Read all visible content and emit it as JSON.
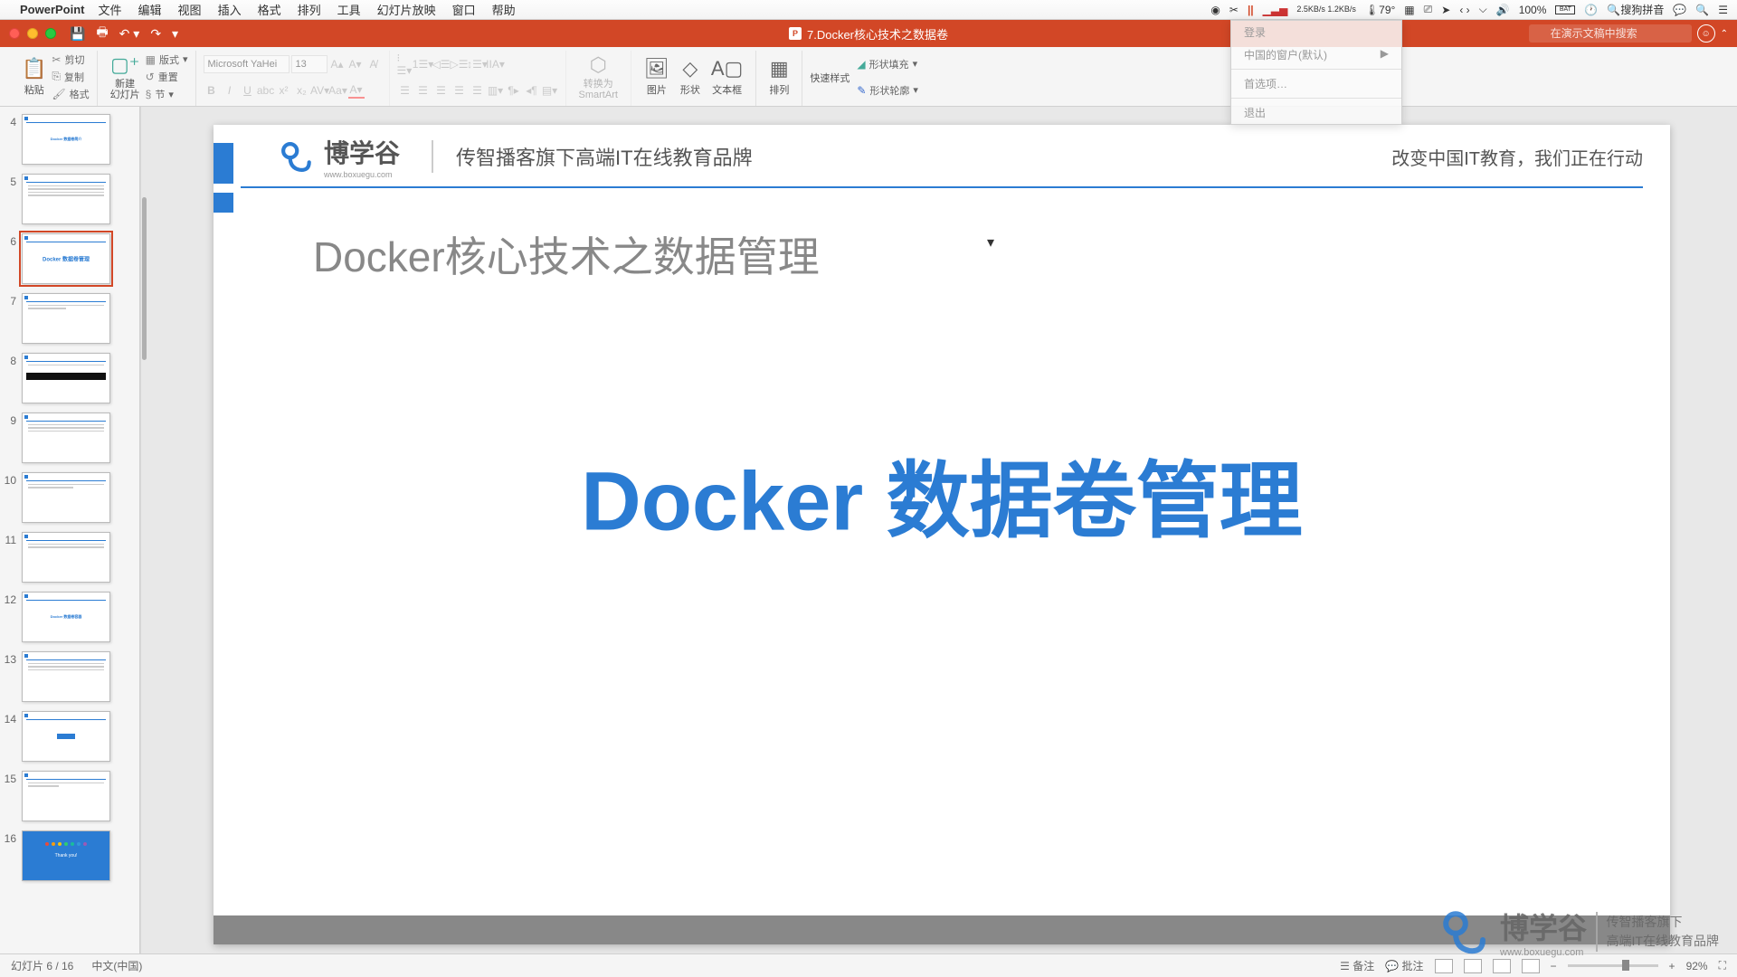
{
  "mac_menu": {
    "app_name": "PowerPoint",
    "items": [
      "文件",
      "编辑",
      "视图",
      "插入",
      "格式",
      "排列",
      "工具",
      "幻灯片放映",
      "窗口",
      "帮助"
    ]
  },
  "tray": {
    "net_speed": "2.5KB/s\n1.2KB/s",
    "temp": "79°",
    "battery": "100%",
    "batt_label": "BAT",
    "ime": "搜狗拼音",
    "time": ""
  },
  "titlebar": {
    "doc_title": "7.Docker核心技术之数据卷",
    "search_placeholder": "在演示文稿中搜索"
  },
  "ribbon": {
    "paste": "粘贴",
    "cut": "剪切",
    "copy": "复制",
    "format_painter": "格式",
    "new_slide": "新建\n幻灯片",
    "layout": "版式",
    "reset": "重置",
    "section": "节",
    "font_name": "Microsoft YaHei",
    "font_size": "13",
    "convert_smartart": "转换为\nSmartArt",
    "picture": "图片",
    "shapes": "形状",
    "textbox": "文本框",
    "arrange": "排列",
    "quick_styles": "快速样式",
    "shape_fill": "形状填充",
    "shape_outline": "形状轮廓"
  },
  "slides": {
    "visible_numbers": [
      4,
      5,
      6,
      7,
      8,
      9,
      10,
      11,
      12,
      13,
      14,
      15,
      16
    ],
    "selected": 6
  },
  "current_slide": {
    "logo_cn": "博学谷",
    "logo_en": "www.boxuegu.com",
    "tagline": "传智播客旗下高端IT在线教育品牌",
    "header_right": "改变中国IT教育，我们正在行动",
    "subtitle": "Docker核心技术之数据管理",
    "main_title": "Docker 数据卷管理"
  },
  "status": {
    "slide_info": "幻灯片 6 / 16",
    "language": "中文(中国)",
    "notes": "备注",
    "notes2": "批注",
    "zoom": "92%"
  },
  "dropdown": {
    "items": [
      "登录",
      "中国的窗户(默认)",
      "",
      "首选项…",
      "退出"
    ]
  },
  "watermark": {
    "cn": "博学谷",
    "en": "www.boxuegu.com",
    "tag1": "传智播客旗下",
    "tag2": "高端IT在线教育品牌"
  }
}
